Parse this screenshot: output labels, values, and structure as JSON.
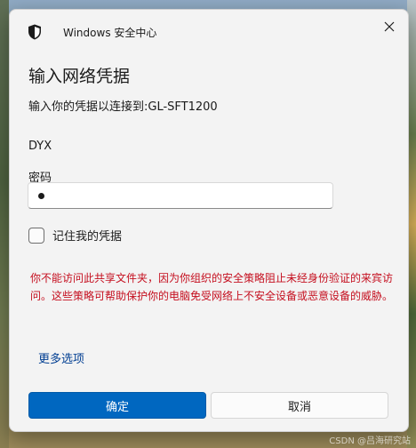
{
  "window": {
    "app_title": "Windows 安全中心",
    "icon": "shield-icon",
    "close_icon": "close-icon"
  },
  "dialog": {
    "heading": "输入网络凭据",
    "subtitle": "输入你的凭据以连接到:GL-SFT1200",
    "username": "DYX",
    "password_label": "密码",
    "password_value_masked": "•",
    "remember_label": "记住我的凭据",
    "remember_checked": false,
    "error_message": "你不能访问此共享文件夹，因为你组织的安全策略阻止未经身份验证的来宾访问。这些策略可帮助保护你的电脑免受网络上不安全设备或恶意设备的威胁。",
    "more_options": "更多选项"
  },
  "buttons": {
    "ok_label": "确定",
    "cancel_label": "取消"
  },
  "watermark": "CSDN @吕海研究站",
  "colors": {
    "accent": "#0067c0",
    "error": "#c50f1f",
    "link": "#003e92"
  }
}
